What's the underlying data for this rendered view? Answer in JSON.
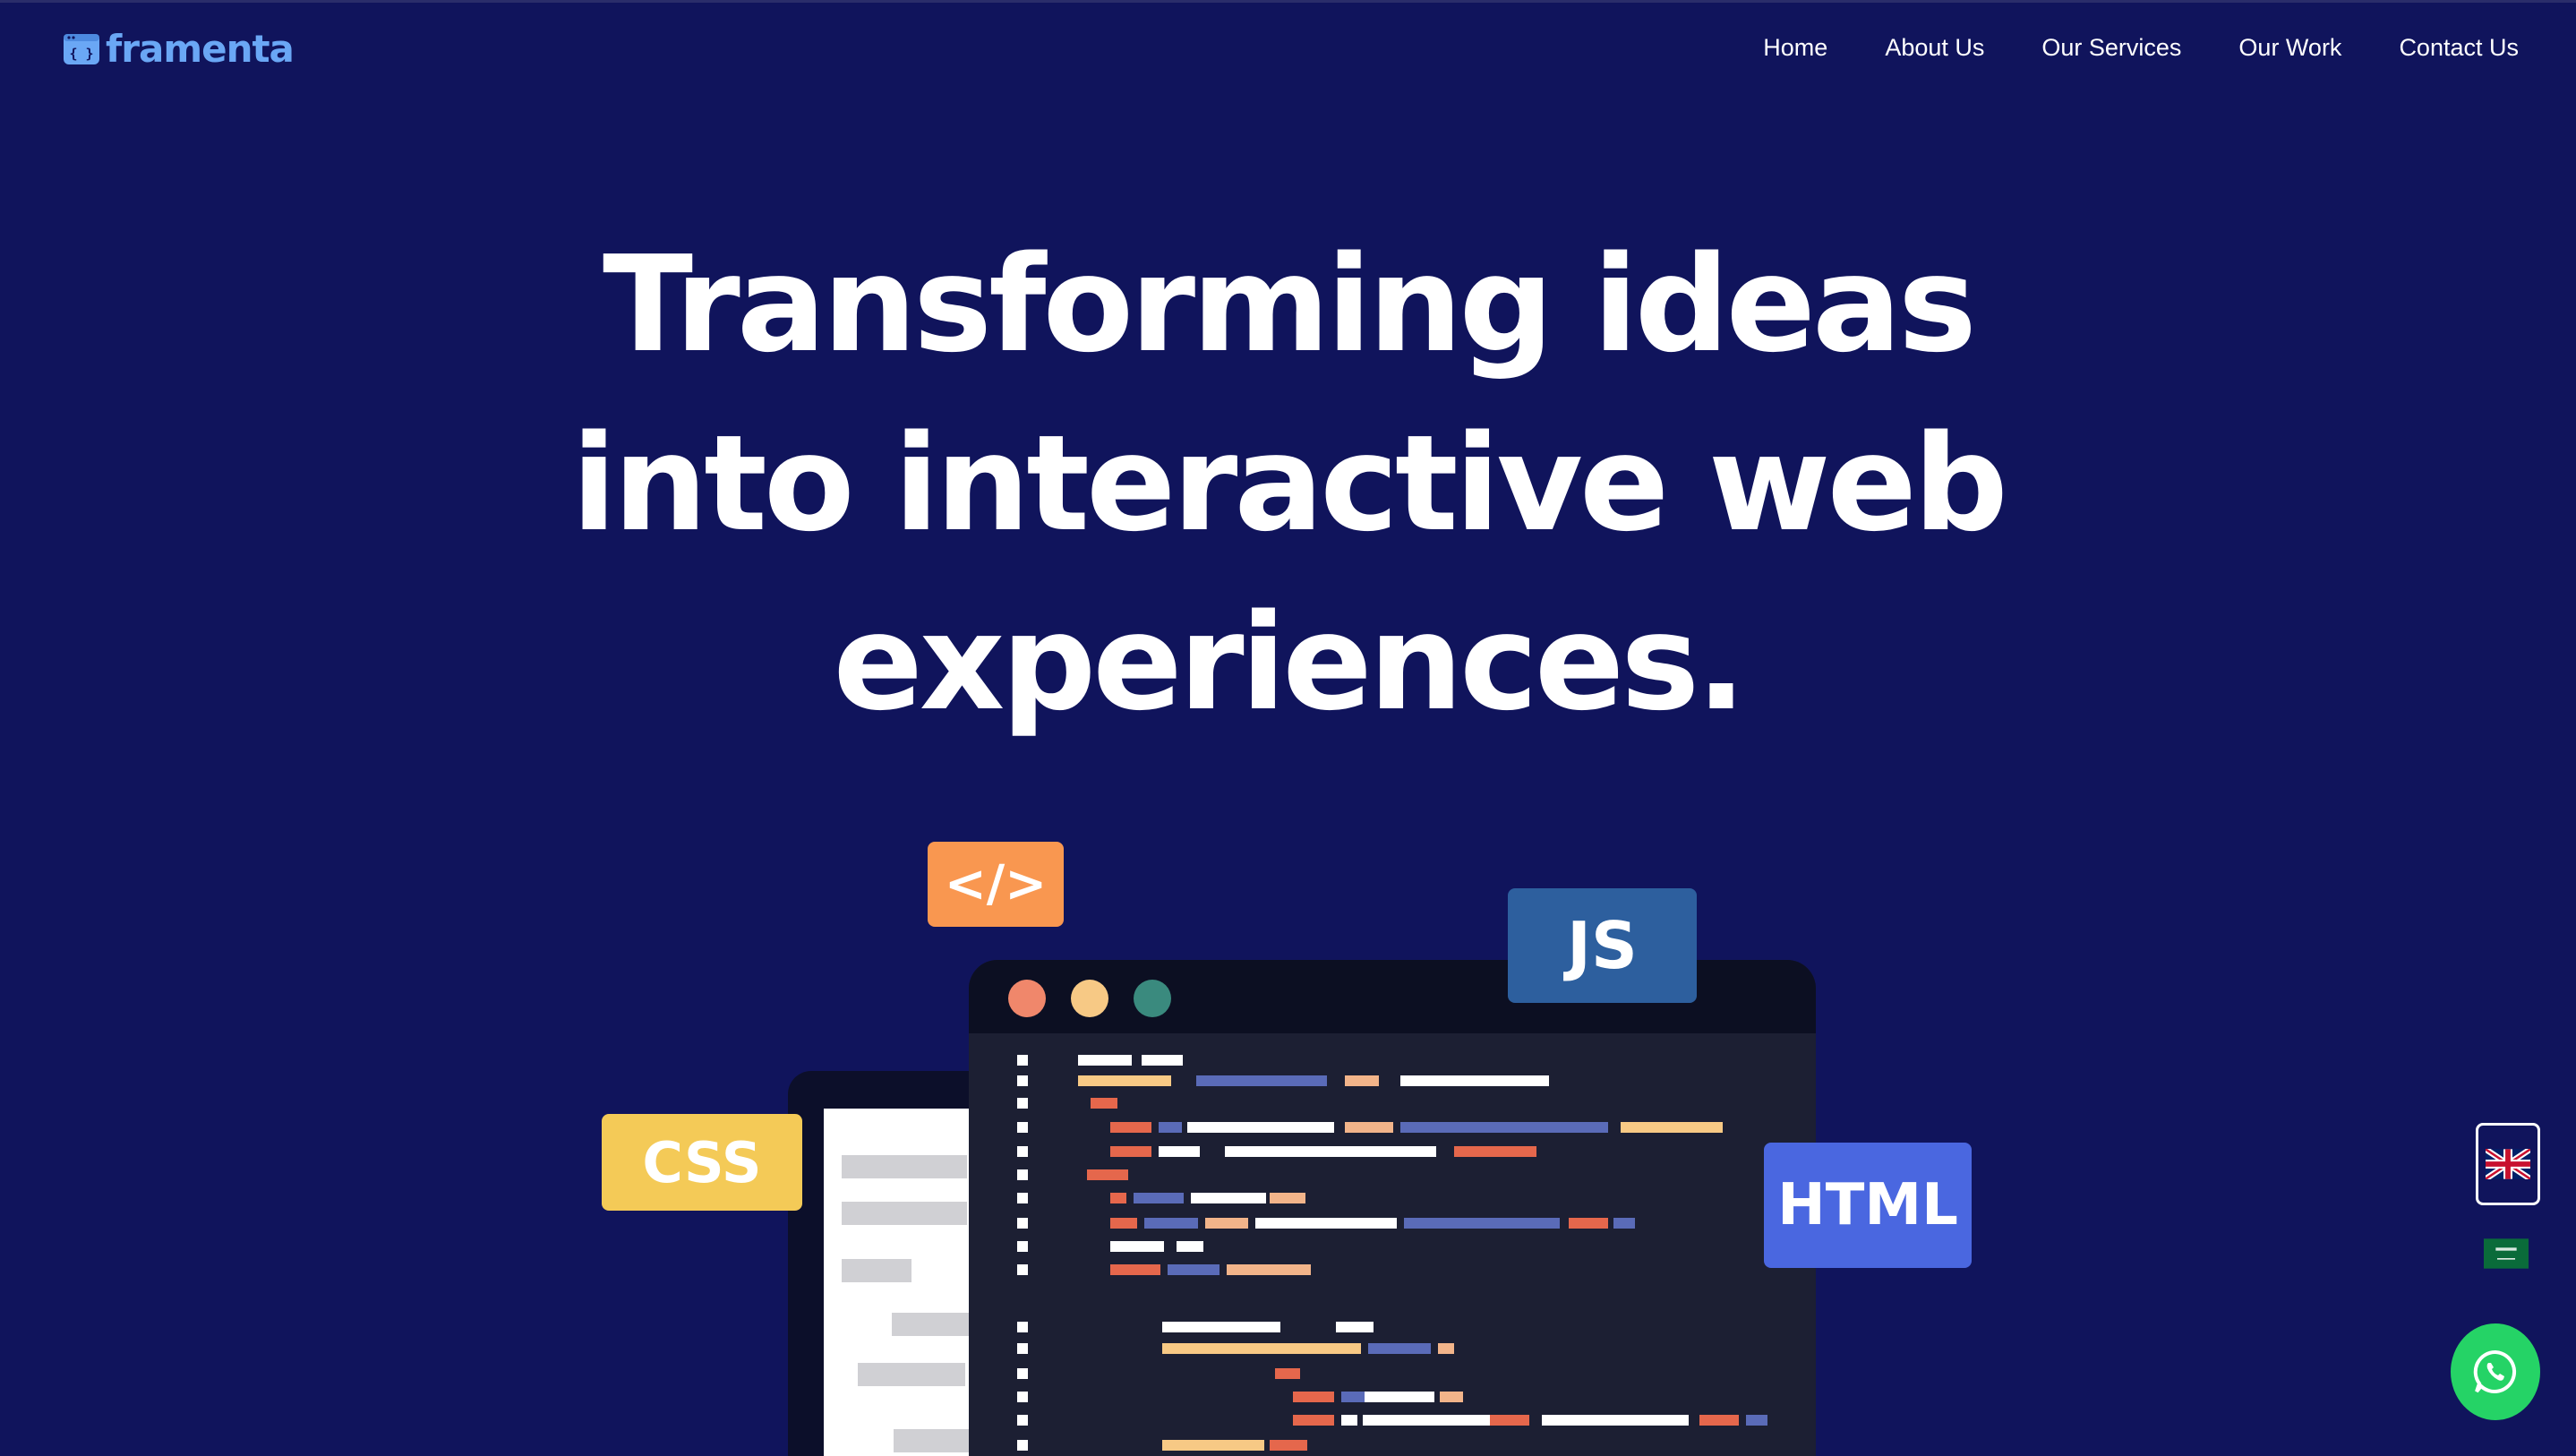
{
  "brand": {
    "name": "framenta",
    "color": "#6aa7f5",
    "icon": "code-window-icon"
  },
  "nav": {
    "items": [
      {
        "label": "Home"
      },
      {
        "label": "About Us"
      },
      {
        "label": "Our Services"
      },
      {
        "label": "Our Work"
      },
      {
        "label": "Contact Us"
      }
    ]
  },
  "hero": {
    "title_lines": [
      "Transforming ideas",
      "into interactive web",
      "experiences."
    ]
  },
  "illustration": {
    "badges": {
      "code": "</>",
      "js": "JS",
      "css": "CSS",
      "html": "HTML"
    },
    "colors": {
      "background": "#10145c",
      "editor": "#1c1f33",
      "dot_red": "#f0876b",
      "dot_yellow": "#f7c985",
      "dot_green": "#3a8a7e"
    }
  },
  "widgets": {
    "language_en": "uk-flag-icon",
    "language_ar": "saudi-flag-icon",
    "whatsapp": "whatsapp-icon"
  }
}
